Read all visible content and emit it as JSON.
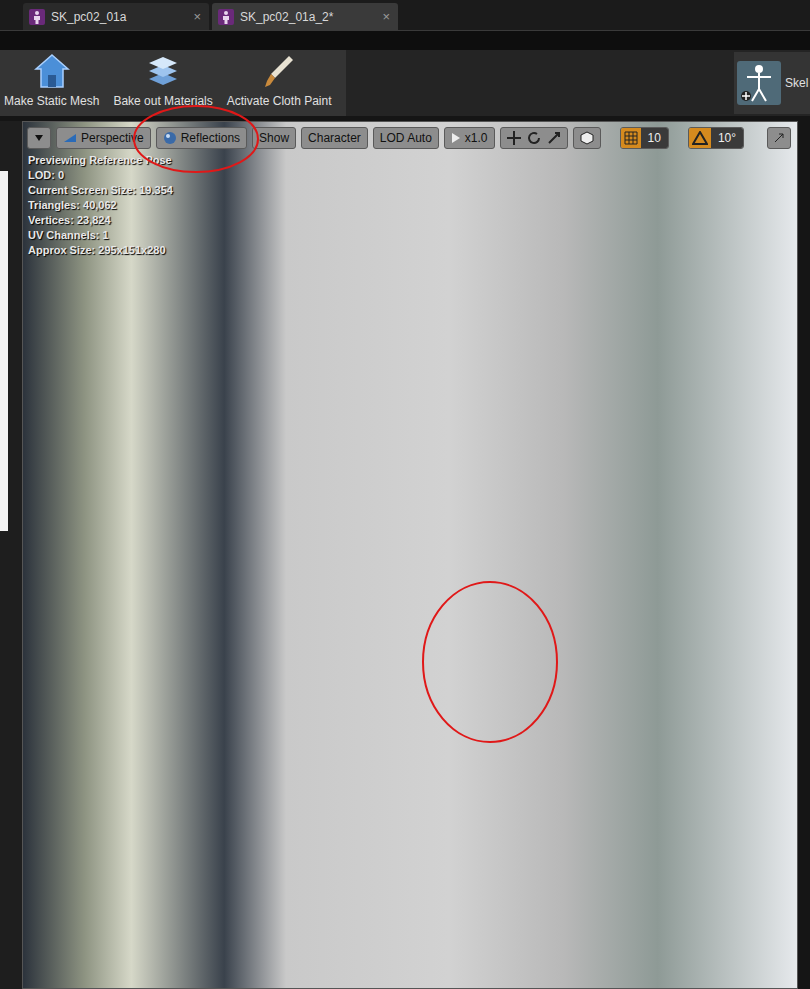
{
  "tabs": [
    {
      "label": "SK_pc02_01a",
      "selected": false,
      "close": "×"
    },
    {
      "label": "SK_pc02_01a_2*",
      "selected": true,
      "close": "×"
    }
  ],
  "toolbar": {
    "buttons": [
      "Make Static Mesh",
      "Bake out Materials",
      "Activate Cloth Paint"
    ],
    "right_button": "Skel"
  },
  "viewport": {
    "buttons": [
      {
        "label": "Perspective"
      },
      {
        "label": "Reflections"
      },
      {
        "label": "Show"
      },
      {
        "label": "Character"
      },
      {
        "label": "LOD Auto"
      }
    ],
    "speed": "x1.0",
    "grid_snap": {
      "value": "10",
      "on": true
    },
    "angle_snap": {
      "value": "10°",
      "on": true
    },
    "stats": [
      "Previewing Reference Pose",
      "LOD: 0",
      "Current Screen Size: 19.354",
      "Triangles: 40,062",
      "Vertices: 23,824",
      "UV Channels: 1",
      "Approx Size: 295x151x280"
    ]
  }
}
